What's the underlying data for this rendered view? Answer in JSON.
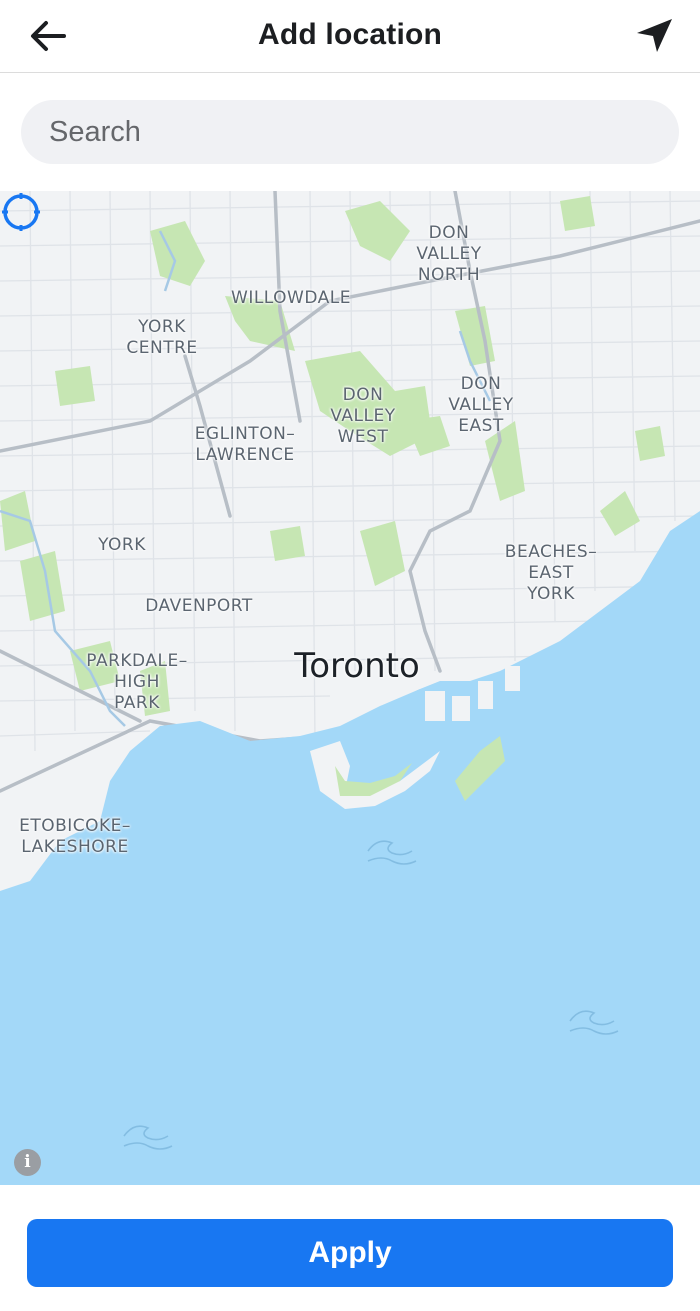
{
  "header": {
    "title": "Add location",
    "back_icon": "arrow-left-icon",
    "location_icon": "navigation-arrow-icon"
  },
  "search": {
    "placeholder": "Search",
    "value": ""
  },
  "map": {
    "city_label": "Toronto",
    "neighborhood_labels": [
      "DON\nVALLEY\nNORTH",
      "WILLOWDALE",
      "YORK\nCENTRE",
      "DON\nVALLEY\nWEST",
      "DON\nVALLEY\nEAST",
      "EGLINTON–\nLAWRENCE",
      "YORK",
      "BEACHES–\nEAST\nYORK",
      "DAVENPORT",
      "PARKDALE–\nHIGH\nPARK",
      "ETOBICOKE–\nLAKESHORE"
    ],
    "marker_icon": "location-target-icon",
    "info_icon": "info-icon",
    "info_label": "i",
    "colors": {
      "water": "#a3d8f8",
      "land": "#f1f3f5",
      "parks": "#c6e6b3",
      "accent": "#1877f2"
    }
  },
  "footer": {
    "apply_label": "Apply"
  }
}
